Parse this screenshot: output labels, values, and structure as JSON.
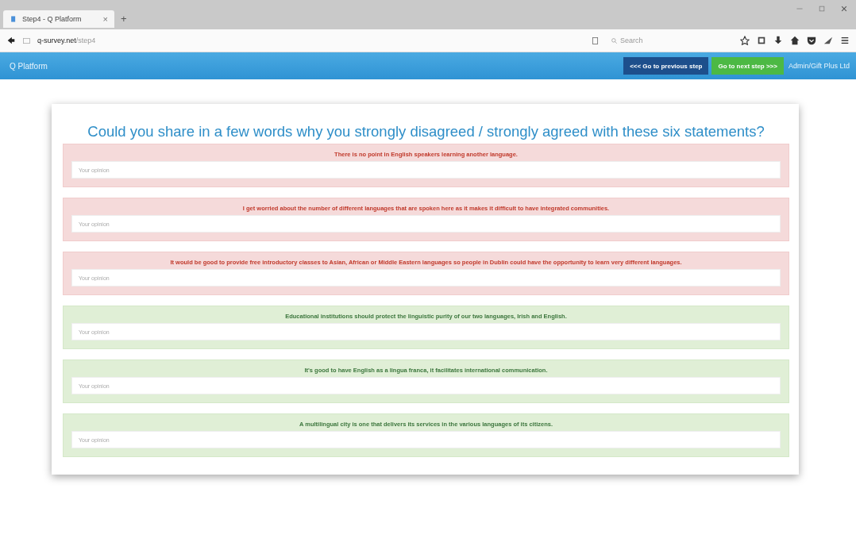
{
  "browser": {
    "tab_title": "Step4 - Q Platform",
    "tab_close": "×",
    "new_tab": "+",
    "url_host": "q-survey.net",
    "url_path": "/step4",
    "search_placeholder": "Search"
  },
  "app_bar": {
    "brand": "Q Platform",
    "previous_button": "<<< Go to previous step",
    "next_button": "Go to next step >>>",
    "user": "Admin/Gift Plus Ltd"
  },
  "survey": {
    "question": "Could you share in a few words why you strongly disagreed / strongly agreed with these six statements?",
    "statements": [
      {
        "kind": "disagree",
        "text": "There is no point in English speakers learning another language.",
        "placeholder": "Your opinion"
      },
      {
        "kind": "disagree",
        "text": "I get worried about the number of different languages that are spoken here as it makes it difficult to have integrated communities.",
        "placeholder": "Your opinion"
      },
      {
        "kind": "disagree",
        "text": "It would be good to provide free introductory classes to Asian, African or Middle Eastern languages so people in Dublin could have the opportunity to learn very different languages.",
        "placeholder": "Your opinion"
      },
      {
        "kind": "agree",
        "text": "Educational institutions should protect the linguistic purity of our two languages, Irish and English.",
        "placeholder": "Your opinion"
      },
      {
        "kind": "agree",
        "text": "It's good to have English as a lingua franca, it facilitates international communication.",
        "placeholder": "Your opinion"
      },
      {
        "kind": "agree",
        "text": "A multilingual city is one that delivers its services in the various languages of its citizens.",
        "placeholder": "Your opinion"
      }
    ]
  }
}
